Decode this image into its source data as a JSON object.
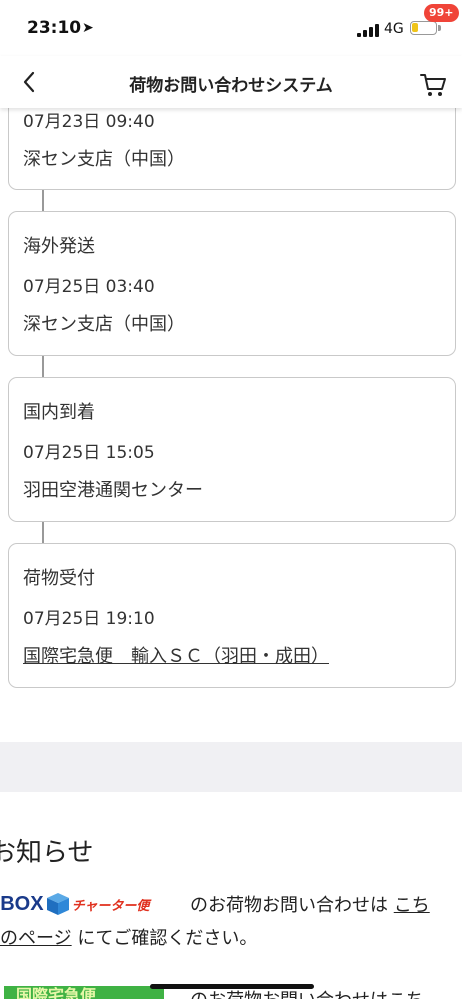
{
  "status_bar": {
    "time": "23:10",
    "network": "4G"
  },
  "nav": {
    "title": "荷物お問い合わせシステム",
    "cart_badge": "99+"
  },
  "timeline": [
    {
      "status": "",
      "time": "07月23日 09:40",
      "place": "深セン支店（中国）",
      "is_link": false
    },
    {
      "status": "海外発送",
      "time": "07月25日 03:40",
      "place": "深セン支店（中国）",
      "is_link": false
    },
    {
      "status": "国内到着",
      "time": "07月25日 15:05",
      "place": "羽田空港通関センター",
      "is_link": false
    },
    {
      "status": "荷物受付",
      "time": "07月25日 19:10",
      "place": "国際宅急便　輸入ＳＣ（羽田・成田）",
      "is_link": true
    }
  ],
  "notice": {
    "title": "お知らせ",
    "logo_text": "TBOX",
    "logo_sub": "チャーター便",
    "line1_text": "のお荷物お問い合わせは",
    "line1_link": "こち",
    "line2_link": "のページ",
    "line2_text": "にてご確認ください。",
    "bottom_logo": "国際宅急便",
    "bottom_text": "のお荷物お問い合わせはこち"
  },
  "colors": {
    "badge": "#f04438",
    "logo_blue": "#1a3a8a",
    "logo_red": "#e0301e",
    "green_logo": "#3fb244",
    "gray_band": "#f0f0f3"
  }
}
